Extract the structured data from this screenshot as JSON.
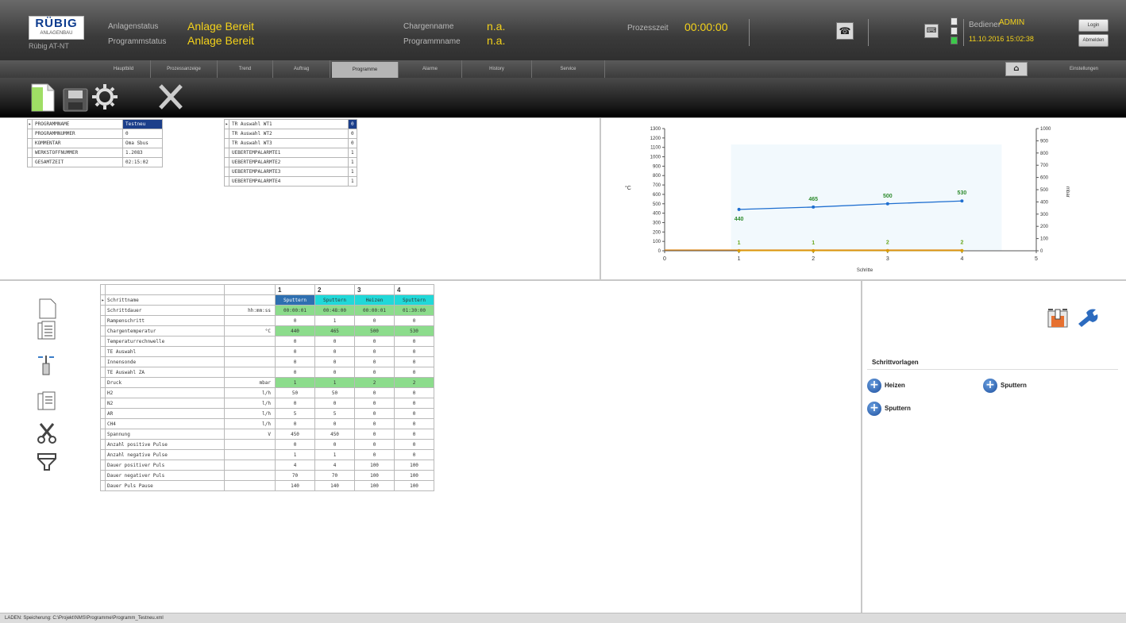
{
  "header": {
    "logo_text": "RÜBIG",
    "logo_sub": "ANLAGENBAU",
    "machine_label": "Rübig AT-NT",
    "anlagenstatus_label": "Anlagenstatus",
    "anlagenstatus_value": "Anlage Bereit",
    "programmstatus_label": "Programmstatus",
    "programmstatus_value": "Anlage Bereit",
    "chargenname_label": "Chargenname",
    "chargenname_value": "n.a.",
    "programmname_label": "Programmname",
    "programmname_value": "n.a.",
    "prozesszeit_label": "Prozesszeit",
    "prozesszeit_value": "00:00:00",
    "bediener_label": "Bediener",
    "bediener_value": "ADMIN",
    "datetime": "11.10.2016 15:02:38",
    "login_label": "Login",
    "logout_label": "Abmelden"
  },
  "nav": {
    "tabs": [
      "Hauptbild",
      "Prozessanzeige",
      "Trend",
      "Auftrag",
      "Programme",
      "Alarme",
      "History",
      "Service"
    ],
    "active": "Programme",
    "end_label": "Einstellungen"
  },
  "program_params": [
    {
      "key": "PROGRAMMNAME",
      "value": "Testneu",
      "selected": true
    },
    {
      "key": "PROGRAMMNUMMER",
      "value": "0"
    },
    {
      "key": "KOMMENTAR",
      "value": "Oma Sbus"
    },
    {
      "key": "WERKSTOFFNUMMER",
      "value": "1.2083"
    },
    {
      "key": "GESAMTZEIT",
      "value": "02:15:02"
    }
  ],
  "tr_params": [
    {
      "key": "TR Auswahl WT1",
      "value": "0",
      "selected": true
    },
    {
      "key": "TR Auswahl WT2",
      "value": "0"
    },
    {
      "key": "TR Auswahl WT3",
      "value": "0"
    },
    {
      "key": "UEBERTEMPALARMTE1",
      "value": "1"
    },
    {
      "key": "UEBERTEMPALARMTE2",
      "value": "1"
    },
    {
      "key": "UEBERTEMPALARMTE3",
      "value": "1"
    },
    {
      "key": "UEBERTEMPALARMTE4",
      "value": "1"
    }
  ],
  "chart_data": {
    "type": "line",
    "x": [
      1,
      2,
      3,
      4
    ],
    "series": [
      {
        "values": [
          440,
          465,
          500,
          530
        ],
        "axis": "left",
        "color": "#1f6fd0"
      },
      {
        "values": [
          1,
          1,
          2,
          2
        ],
        "axis": "right",
        "color": "#d9a400"
      }
    ],
    "xlabel": "Schritte",
    "ylabel_left": "°C",
    "ylabel_right": "mbar",
    "xlim": [
      0,
      5
    ],
    "ylim_left": [
      0,
      1300
    ],
    "ylim_right": [
      0,
      1000
    ],
    "yticks_left": [
      0,
      100,
      200,
      300,
      400,
      500,
      600,
      700,
      800,
      900,
      1000,
      1100,
      1200,
      1300
    ],
    "yticks_right": [
      0,
      100,
      200,
      300,
      400,
      500,
      600,
      700,
      800,
      900,
      1000
    ],
    "xticks": [
      0,
      1,
      2,
      3,
      4,
      5
    ],
    "grid": false
  },
  "steps": {
    "headers": [
      "1",
      "2",
      "3",
      "4"
    ],
    "rows": [
      {
        "name": "Schrittname",
        "unit": "",
        "values": [
          "Sputtern",
          "Sputtern",
          "Heizen",
          "Sputtern"
        ],
        "style": "cyan",
        "marked": true
      },
      {
        "name": "Schrittdauer",
        "unit": "hh:mm:ss",
        "values": [
          "00:00:01",
          "00:48:00",
          "00:00:01",
          "01:30:00"
        ],
        "style": "green"
      },
      {
        "name": "Rampenschritt",
        "unit": "",
        "values": [
          "0",
          "1",
          "0",
          "0"
        ]
      },
      {
        "name": "Chargentemperatur",
        "unit": "°C",
        "values": [
          "440",
          "465",
          "500",
          "530"
        ],
        "style": "green"
      },
      {
        "name": "Temperaturrechnwelle",
        "unit": "",
        "values": [
          "0",
          "0",
          "0",
          "0"
        ]
      },
      {
        "name": "TE Auswahl",
        "unit": "",
        "values": [
          "0",
          "0",
          "0",
          "0"
        ]
      },
      {
        "name": "Innensonde",
        "unit": "",
        "values": [
          "0",
          "0",
          "0",
          "0"
        ]
      },
      {
        "name": "TE Auswahl ZA",
        "unit": "",
        "values": [
          "0",
          "0",
          "0",
          "0"
        ]
      },
      {
        "name": "Druck",
        "unit": "mbar",
        "values": [
          "1",
          "1",
          "2",
          "2"
        ],
        "style": "green"
      },
      {
        "name": "H2",
        "unit": "l/h",
        "values": [
          "50",
          "50",
          "0",
          "0"
        ]
      },
      {
        "name": "N2",
        "unit": "l/h",
        "values": [
          "0",
          "0",
          "0",
          "0"
        ]
      },
      {
        "name": "AR",
        "unit": "l/h",
        "values": [
          "5",
          "5",
          "0",
          "0"
        ]
      },
      {
        "name": "CH4",
        "unit": "l/h",
        "values": [
          "0",
          "0",
          "0",
          "0"
        ]
      },
      {
        "name": "Spannung",
        "unit": "V",
        "values": [
          "450",
          "450",
          "0",
          "0"
        ]
      },
      {
        "name": "Anzahl positive Pulse",
        "unit": "",
        "values": [
          "0",
          "0",
          "0",
          "0"
        ]
      },
      {
        "name": "Anzahl negative Pulse",
        "unit": "",
        "values": [
          "1",
          "1",
          "0",
          "0"
        ]
      },
      {
        "name": "Dauer positiver Puls",
        "unit": "",
        "values": [
          "4",
          "4",
          "100",
          "100"
        ]
      },
      {
        "name": "Dauer negativer Puls",
        "unit": "",
        "values": [
          "70",
          "70",
          "100",
          "100"
        ]
      },
      {
        "name": "Dauer Puls Pause",
        "unit": "",
        "values": [
          "140",
          "140",
          "100",
          "100"
        ]
      }
    ]
  },
  "templates": {
    "title": "Schrittvorlagen",
    "items": [
      "Heizen",
      "Sputtern",
      "Sputtern"
    ]
  },
  "status": {
    "text": "LADEN: Speicherung: C:\\Projekt\\NMS\\Programme\\Programm_Testneu.xml"
  },
  "colors": {
    "accent_yellow": "#f4d21a",
    "green_cell": "#8cdc8c",
    "cyan_cell": "#20d8d8",
    "selection_blue": "#1c3f8a"
  }
}
